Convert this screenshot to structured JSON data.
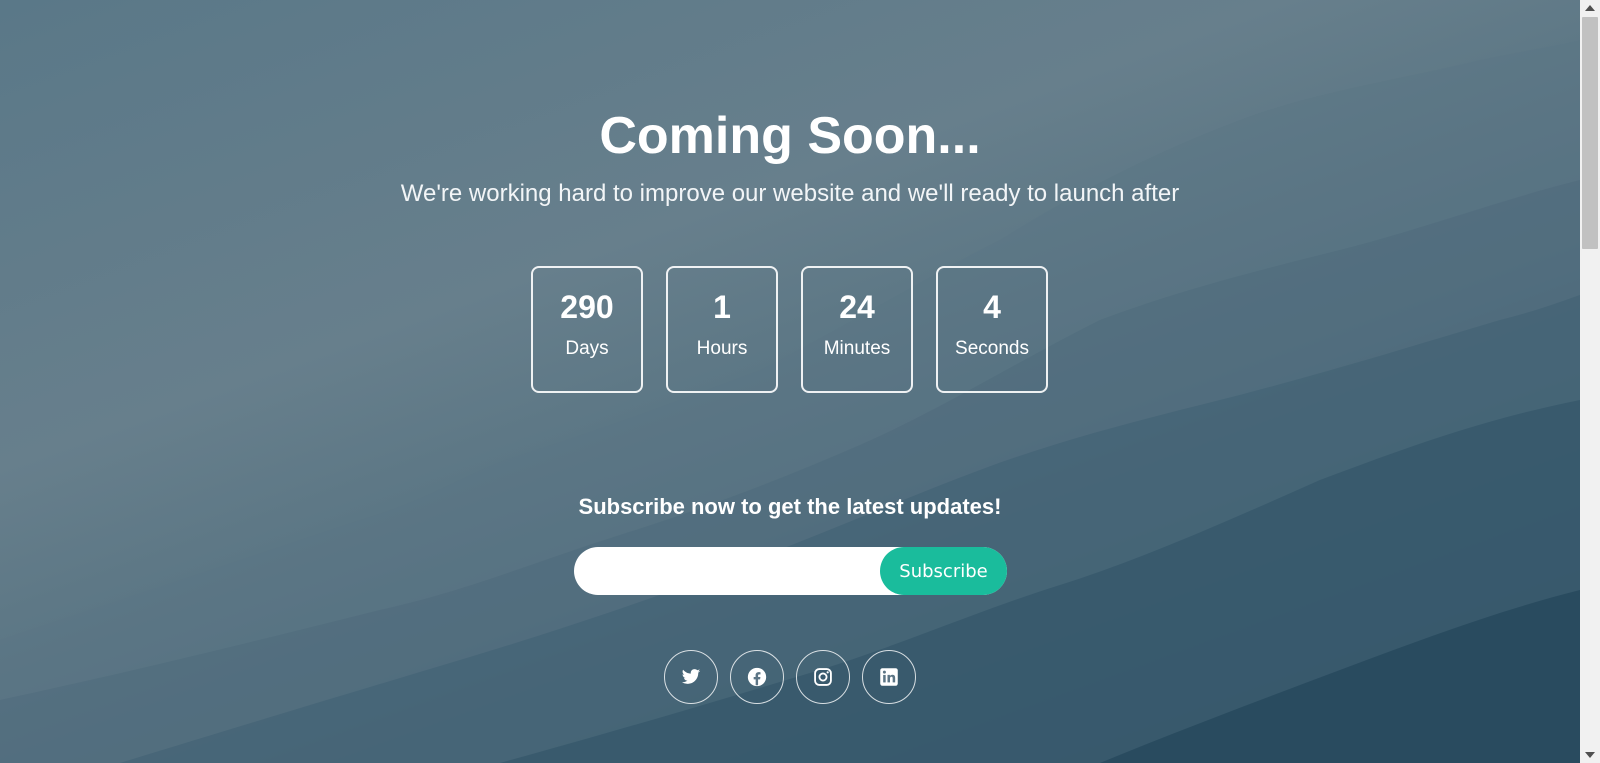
{
  "hero": {
    "title": "Coming Soon...",
    "subtitle": "We're working hard to improve our website and we'll ready to launch after"
  },
  "countdown": [
    {
      "value": "290",
      "label": "Days"
    },
    {
      "value": "1",
      "label": "Hours"
    },
    {
      "value": "24",
      "label": "Minutes"
    },
    {
      "value": "4",
      "label": "Seconds"
    }
  ],
  "subscribe": {
    "heading": "Subscribe now to get the latest updates!",
    "email_value": "",
    "email_placeholder": "",
    "button_label": "Subscribe"
  },
  "socials": [
    {
      "icon": "twitter-icon"
    },
    {
      "icon": "facebook-icon"
    },
    {
      "icon": "instagram-icon"
    },
    {
      "icon": "linkedin-icon"
    }
  ],
  "colors": {
    "accent": "#1abc9c",
    "text": "#ffffff",
    "background_top": "#5a7888",
    "background_bottom": "#1f4254"
  }
}
